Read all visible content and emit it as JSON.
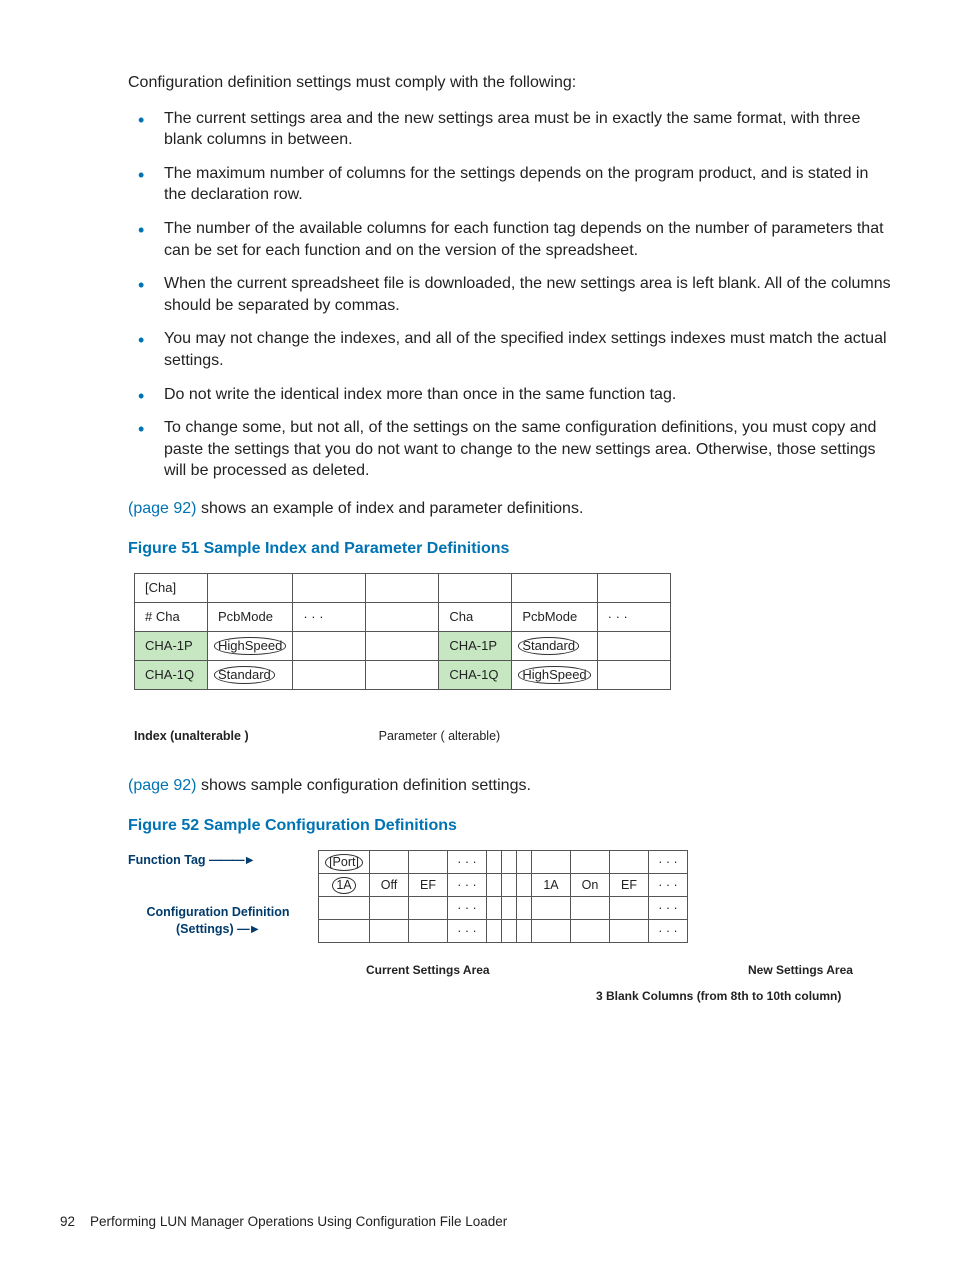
{
  "intro": "Configuration definition settings must comply with the following:",
  "bullets": [
    "The current settings area and the new settings area must be in exactly the same format, with three blank columns in between.",
    "The maximum number of columns for the settings depends on the program product, and is stated in the declaration row.",
    "The number of the available columns for each function tag depends on the number of parameters that can be set for each function and on the version of the spreadsheet.",
    "When the current spreadsheet file is downloaded, the new settings area is left blank. All of the columns should be separated by commas.",
    "You may not change the indexes, and all of the specified index settings indexes must match the actual settings.",
    "Do not write the identical index more than once in the same function tag.",
    "To change some, but not all, of the settings on the same configuration definitions, you must copy and paste the settings that you do not want to change to the new settings area. Otherwise, those settings will be processed as deleted."
  ],
  "ref1": {
    "link": "(page 92)",
    "text": " shows an example of index and parameter definitions."
  },
  "fig51_caption": "Figure 51 Sample Index and Parameter Definitions",
  "fig51": {
    "r1": [
      "[Cha]",
      "",
      "",
      "",
      "",
      "",
      ""
    ],
    "r2": [
      "# Cha",
      "PcbMode",
      "· · ·",
      "",
      "Cha",
      "PcbMode",
      "· · ·"
    ],
    "r3": [
      "CHA-1P",
      "HighSpeed",
      "",
      "",
      "CHA-1P",
      "Standard",
      ""
    ],
    "r4": [
      "CHA-1Q",
      "Standard",
      "",
      "",
      "CHA-1Q",
      "HighSpeed",
      ""
    ],
    "index_label": "Index (unalterable )",
    "param_label": "Parameter ( alterable)"
  },
  "ref2": {
    "link": "(page 92)",
    "text": " shows sample configuration definition settings."
  },
  "fig52_caption": "Figure 52 Sample Configuration Definitions",
  "fig52": {
    "func_tag": "Function Tag",
    "conf_def": "Configuration Definition (Settings)",
    "r1": [
      "[Port]",
      "",
      "",
      "· · ·",
      "",
      "",
      "",
      "",
      "",
      "",
      "· · ·"
    ],
    "r2": [
      "1A",
      "Off",
      "EF",
      "· · ·",
      "",
      "",
      "",
      "1A",
      "On",
      "EF",
      "· · ·"
    ],
    "r3": [
      "",
      "",
      "",
      "· · ·",
      "",
      "",
      "",
      "",
      "",
      "",
      "· · ·"
    ],
    "r4": [
      "",
      "",
      "",
      "· · ·",
      "",
      "",
      "",
      "",
      "",
      "",
      "· · ·"
    ],
    "csa": "Current Settings Area",
    "nsa": "New Settings Area",
    "blank": "3 Blank Columns (from 8th to 10th column)"
  },
  "footer": {
    "num": "92",
    "text": "Performing LUN Manager Operations Using Configuration File Loader"
  }
}
